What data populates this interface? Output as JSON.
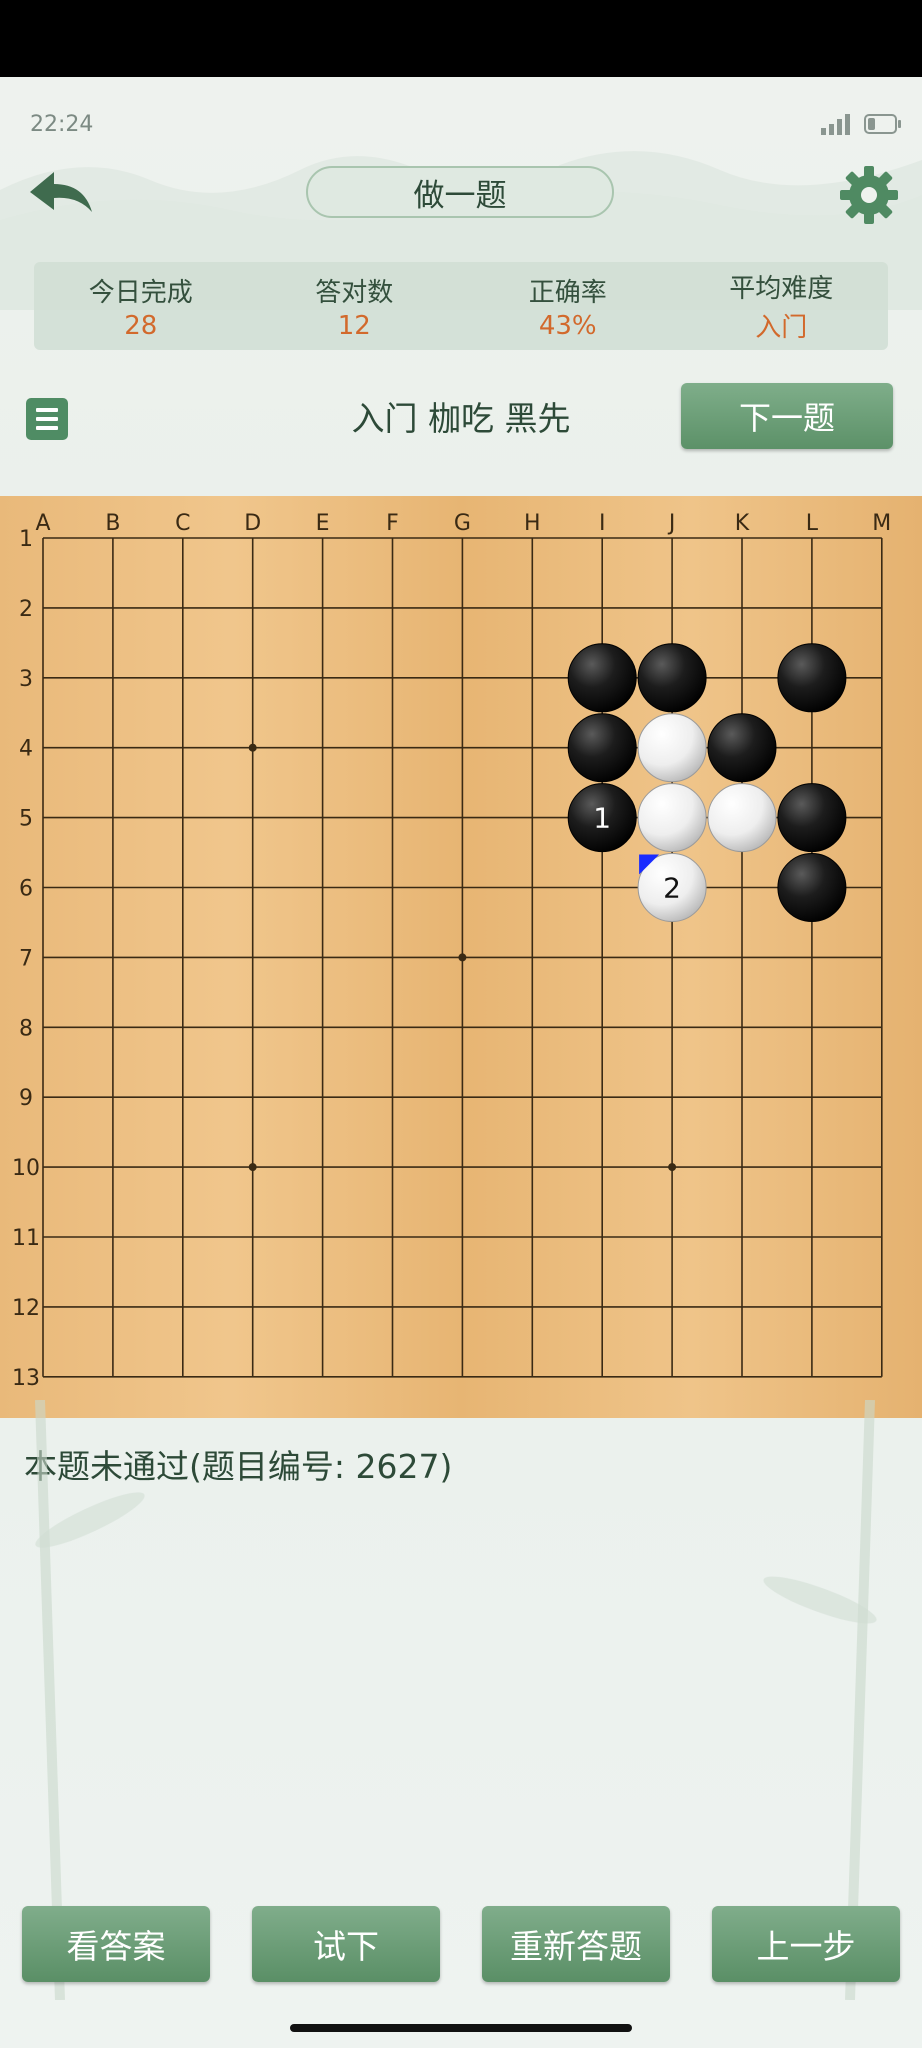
{
  "status_bar": {
    "time": "22:24"
  },
  "header": {
    "title": "做一题"
  },
  "stats": [
    {
      "label": "今日完成",
      "value": "28"
    },
    {
      "label": "答对数",
      "value": "12"
    },
    {
      "label": "正确率",
      "value": "43%"
    },
    {
      "label": "平均难度",
      "value": "入门"
    }
  ],
  "problem": {
    "title": "入门 枷吃 黑先",
    "next_label": "下一题"
  },
  "board": {
    "size": 13,
    "columns": [
      "A",
      "B",
      "C",
      "D",
      "E",
      "F",
      "G",
      "H",
      "I",
      "J",
      "K",
      "L",
      "M"
    ],
    "rows": [
      "1",
      "2",
      "3",
      "4",
      "5",
      "6",
      "7",
      "8",
      "9",
      "10",
      "11",
      "12",
      "13"
    ],
    "star_points": [
      [
        "D",
        4
      ],
      [
        "G",
        7
      ],
      [
        "D",
        10
      ],
      [
        "J",
        10
      ]
    ],
    "stones": [
      {
        "color": "black",
        "col": "I",
        "row": 3
      },
      {
        "color": "black",
        "col": "J",
        "row": 3
      },
      {
        "color": "black",
        "col": "L",
        "row": 3
      },
      {
        "color": "black",
        "col": "I",
        "row": 4
      },
      {
        "color": "white",
        "col": "J",
        "row": 4
      },
      {
        "color": "black",
        "col": "K",
        "row": 4
      },
      {
        "color": "black",
        "col": "I",
        "row": 5,
        "label": "1"
      },
      {
        "color": "white",
        "col": "J",
        "row": 5
      },
      {
        "color": "white",
        "col": "K",
        "row": 5
      },
      {
        "color": "black",
        "col": "L",
        "row": 5
      },
      {
        "color": "white",
        "col": "J",
        "row": 6,
        "label": "2",
        "last_move": true
      },
      {
        "color": "black",
        "col": "L",
        "row": 6
      }
    ]
  },
  "result": {
    "text": "本题未通过(题目编号: 2627)"
  },
  "bottom_buttons": [
    {
      "label": "看答案"
    },
    {
      "label": "试下"
    },
    {
      "label": "重新答题"
    },
    {
      "label": "上一步"
    }
  ],
  "colors": {
    "accent": "#5c9168",
    "stat_value": "#d2692c",
    "board": "#e8b873",
    "last_move_marker": "#1a2cff"
  }
}
